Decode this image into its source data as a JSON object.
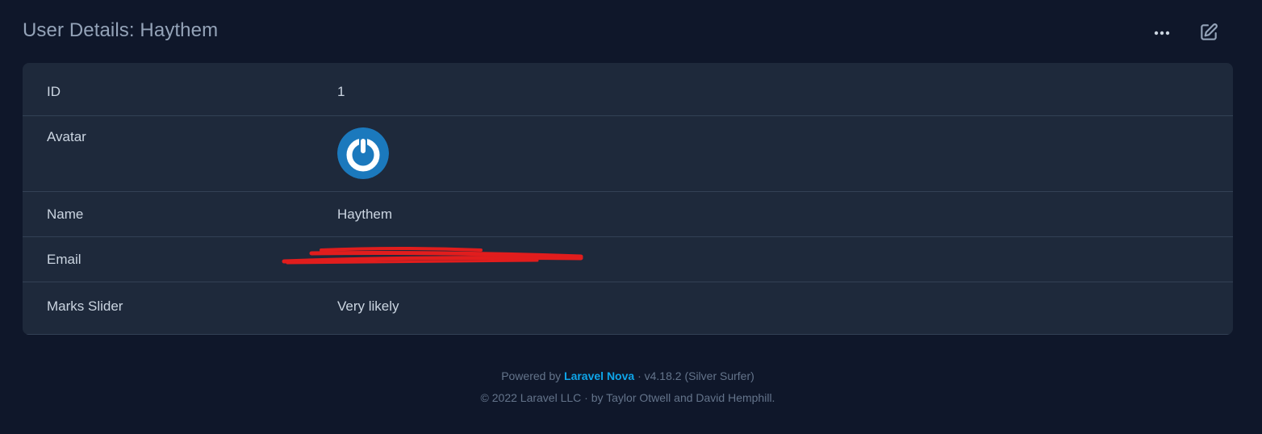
{
  "header": {
    "title": "User Details: Haythem",
    "actions_icon": "ellipsis-horizontal-icon",
    "edit_icon": "pencil-square-icon"
  },
  "details": {
    "rows": [
      {
        "label": "ID",
        "value": "1"
      },
      {
        "label": "Avatar",
        "value": ""
      },
      {
        "label": "Name",
        "value": "Haythem"
      },
      {
        "label": "Email",
        "value": ""
      },
      {
        "label": "Marks Slider",
        "value": "Very likely"
      }
    ]
  },
  "footer": {
    "powered_prefix": "Powered by",
    "brand": "Laravel Nova",
    "version": "· v4.18.2 (Silver Surfer)",
    "copyright": "© 2022 Laravel LLC · by Taylor Otwell and David Hemphill."
  },
  "colors": {
    "background": "#0f172a",
    "card": "#1e293b",
    "divider": "#334155",
    "accent": "#0ea5e9",
    "redaction": "#e11d1d",
    "avatar_blue": "#1b79bd"
  }
}
